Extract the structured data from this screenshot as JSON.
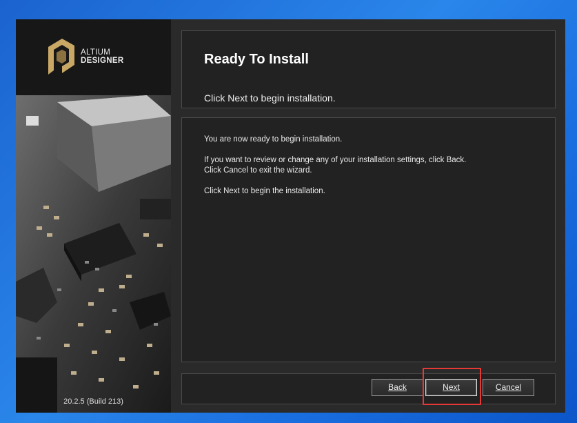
{
  "brand": {
    "line1": "ALTIUM",
    "line2": "DESIGNER"
  },
  "version": "20.2.5 (Build 213)",
  "header": {
    "title": "Ready To Install",
    "subtitle": "Click Next to begin installation."
  },
  "content": {
    "p1": "You are now ready to begin installation.",
    "p2a": "If you want to review or change any of your installation settings, click Back.",
    "p2b": "Click Cancel to exit the wizard.",
    "p3": "Click Next to begin the installation."
  },
  "buttons": {
    "back": "Back",
    "next": "Next",
    "cancel": "Cancel"
  },
  "colors": {
    "desktop": "#1f6fd6",
    "window_bg": "#2a2a2a",
    "logo_gold": "#c9a866",
    "highlight": "#e53935"
  }
}
